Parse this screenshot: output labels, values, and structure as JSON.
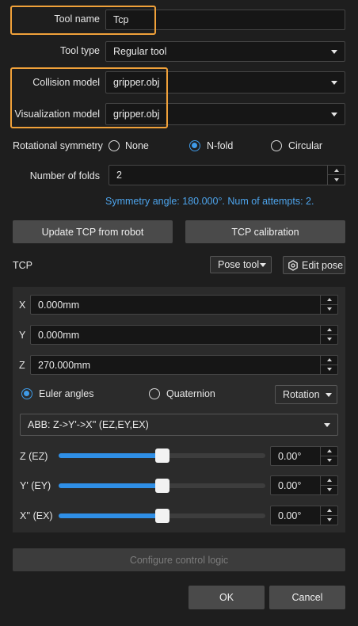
{
  "tool_name": {
    "label": "Tool name",
    "value": "Tcp"
  },
  "tool_type": {
    "label": "Tool type",
    "value": "Regular tool"
  },
  "collision_model": {
    "label": "Collision model",
    "value": "gripper.obj"
  },
  "visualization_model": {
    "label": "Visualization model",
    "value": "gripper.obj"
  },
  "rotational_symmetry": {
    "label": "Rotational symmetry",
    "options": [
      "None",
      "N-fold",
      "Circular"
    ],
    "selected": "N-fold"
  },
  "number_of_folds": {
    "label": "Number of folds",
    "value": "2"
  },
  "symmetry_info": "Symmetry angle: 180.000°. Num of attempts: 2.",
  "buttons": {
    "update_tcp": "Update TCP from robot",
    "tcp_calibration": "TCP calibration",
    "configure_logic": "Configure control logic",
    "ok": "OK",
    "cancel": "Cancel"
  },
  "tcp": {
    "label": "TCP",
    "pose_tool": "Pose tool",
    "edit_pose": "Edit pose",
    "x": {
      "label": "X",
      "value": "0.000mm"
    },
    "y": {
      "label": "Y",
      "value": "0.000mm"
    },
    "z": {
      "label": "Z",
      "value": "270.000mm"
    },
    "orientation": {
      "options": [
        "Euler angles",
        "Quaternion"
      ],
      "selected": "Euler angles"
    },
    "rotation_mode": "Rotation",
    "euler_convention": "ABB: Z->Y'->X'' (EZ,EY,EX)",
    "angles": [
      {
        "label": "Z (EZ)",
        "value": "0.00°",
        "level": 0.5
      },
      {
        "label": "Y' (EY)",
        "value": "0.00°",
        "level": 0.5
      },
      {
        "label": "X'' (EX)",
        "value": "0.00°",
        "level": 0.5
      }
    ]
  },
  "colors": {
    "accent": "#2f8fe6",
    "highlight": "#f0a13a",
    "background": "#1e1e1e",
    "panel": "#2b2b2b"
  }
}
